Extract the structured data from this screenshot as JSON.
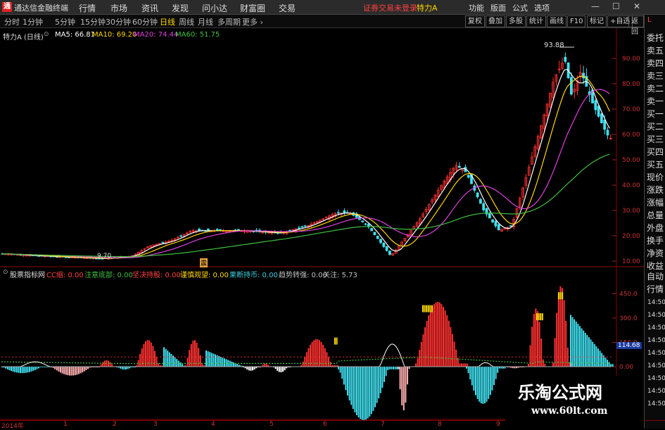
{
  "titlebar": {
    "app_title": "通达信金融终端",
    "logo": "通",
    "menus": [
      "行情",
      "市场",
      "资讯",
      "发现",
      "问小达",
      "财富圈",
      "交易"
    ],
    "warning": "证券交易未登录",
    "stock_name": "特力A",
    "right_menus": [
      "功能",
      "版面",
      "公式",
      "选项"
    ],
    "window_buttons": [
      "—",
      "☐",
      "✕"
    ]
  },
  "toolbar": {
    "periods": [
      "分时",
      "1分钟",
      "5分钟",
      "15分钟",
      "30分钟",
      "60分钟",
      "日线",
      "周线",
      "月线",
      "多周期",
      "更多 ›"
    ],
    "active_period": "日线",
    "buttons": [
      "复权",
      "叠加",
      "多股",
      "统计",
      "画线",
      "F10",
      "标记",
      "+自选",
      "返回"
    ]
  },
  "right_panel": {
    "items": [
      "委托",
      "卖五",
      "卖四",
      "卖三",
      "卖二",
      "卖一",
      "买一",
      "买二",
      "买三",
      "买四",
      "买五",
      "现价",
      "涨跌",
      "涨幅",
      "总量",
      "外盘",
      "换手",
      "净资",
      "收益"
    ],
    "lower_items": [
      "自动",
      "行情"
    ],
    "corner": "L"
  },
  "main_chart": {
    "title": "特力A (日线)",
    "ma": [
      {
        "label": "MA5: 66.81",
        "color": "#ffffff"
      },
      {
        "label": "MA10: 69.20",
        "color": "#ffd700"
      },
      {
        "label": "MA20: 74.44",
        "color": "#e040e0"
      },
      {
        "label": "MA60: 51.75",
        "color": "#40c040"
      }
    ],
    "y_ticks": [
      "90.00",
      "80.00",
      "70.00",
      "60.00",
      "50.00",
      "40.00",
      "30.00",
      "20.00",
      "10.00"
    ],
    "high_label": "93.88",
    "low_label": "9.70",
    "event_marker": "震"
  },
  "indicator": {
    "name": "股票指标网",
    "items": [
      {
        "label": "CC缩: 0.00",
        "color": "#ff4040"
      },
      {
        "label": "注意底部: 0.00",
        "color": "#40c040"
      },
      {
        "label": "坚决持股: 0.00",
        "color": "#ff4040"
      },
      {
        "label": "谨慎观望: 0.00",
        "color": "#ffd700"
      },
      {
        "label": "果断持币: 0.00",
        "color": "#40d0e0"
      },
      {
        "label": "趋势转强: 0.00",
        "color": "#c0c0c0"
      },
      {
        "label": "关注: 5.73",
        "color": "#c0c0c0"
      }
    ],
    "y_ticks": [
      "450.0",
      "300.0",
      "150.0",
      "0.00"
    ],
    "current": "114.68",
    "right_times": [
      "14:50",
      "14:50",
      "14:50",
      "14:50",
      "14:50",
      "14:50",
      "14:50",
      "14:50",
      "14:50"
    ]
  },
  "time_axis": {
    "labels": [
      "2014年",
      "1",
      "2",
      "3",
      "4",
      "5",
      "6",
      "7",
      "8",
      "9"
    ]
  },
  "watermark": {
    "title": "乐淘公式网",
    "url": "www.60lt.com"
  }
}
